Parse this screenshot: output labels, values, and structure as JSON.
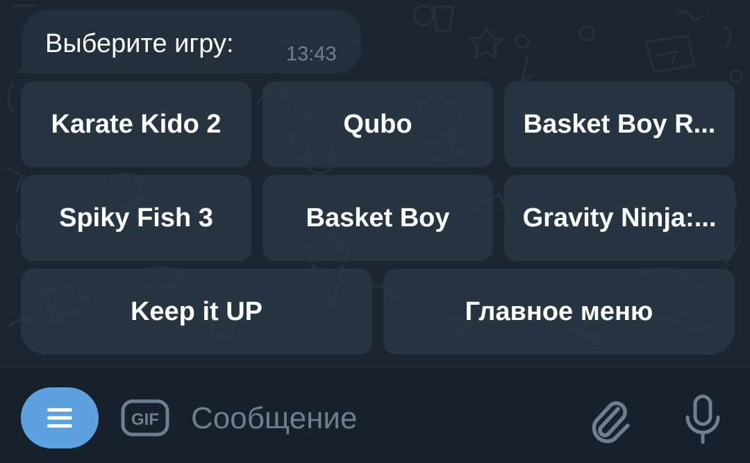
{
  "message": {
    "text": "Выберите игру:",
    "time": "13:43"
  },
  "keyboard": {
    "buttons": [
      "Karate Kido 2",
      "Qubo",
      "Basket Boy R...",
      "Spiky Fish 3",
      "Basket Boy",
      "Gravity Ninja:...",
      "Keep it UP",
      "Главное меню"
    ]
  },
  "input_bar": {
    "placeholder": "Сообщение",
    "menu_icon": "menu-icon",
    "gif_icon": "gif-icon",
    "gif_label": "GIF",
    "attach_icon": "paperclip-icon",
    "voice_icon": "microphone-icon"
  },
  "colors": {
    "accent": "#5da2e0",
    "bubble": "#242f3d",
    "button": "#2a3846",
    "background": "#17212b",
    "timestamp": "#6d8196"
  }
}
